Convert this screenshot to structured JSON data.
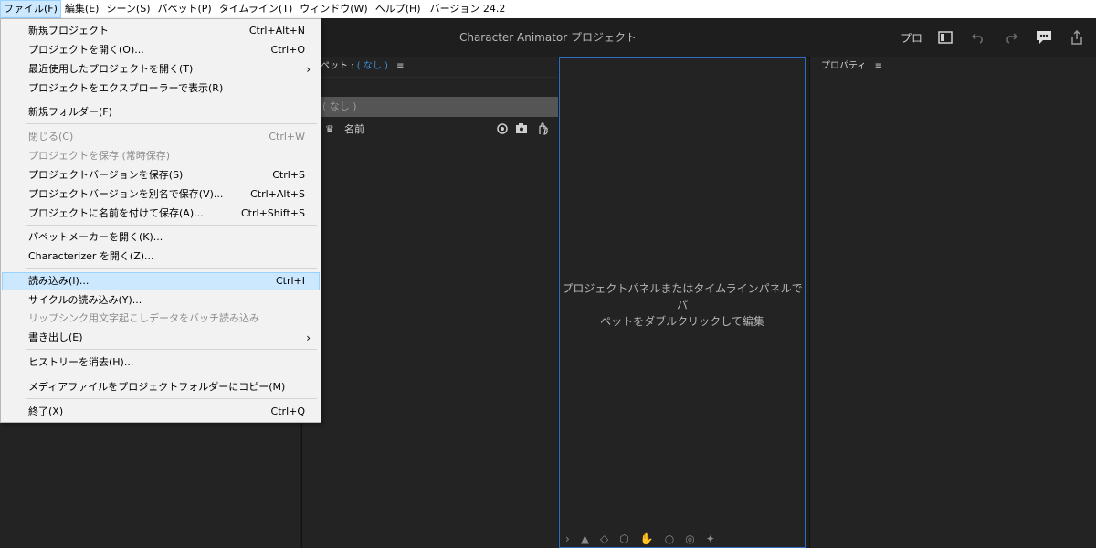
{
  "menubar": {
    "items": [
      "ファイル(F)",
      "編集(E)",
      "シーン(S)",
      "パペット(P)",
      "タイムライン(T)",
      "ウィンドウ(W)",
      "ヘルプ(H)"
    ],
    "version": "バージョン 24.2"
  },
  "header": {
    "title": "Character Animator プロジェクト",
    "mode_label": "プロ"
  },
  "puppet_panel": {
    "title_prefix": "ペット : ",
    "title_value": "( なし )",
    "row_value": "( なし )",
    "column_name": "名前"
  },
  "viewer": {
    "message_line1": "プロジェクトパネルまたはタイムラインパネルでパ",
    "message_line2": "ペットをダブルクリックして編集"
  },
  "properties": {
    "title": "プロパティ"
  },
  "file_menu": {
    "items": [
      {
        "label": "新規プロジェクト",
        "shortcut": "Ctrl+Alt+N"
      },
      {
        "label": "プロジェクトを開く(O)...",
        "shortcut": "Ctrl+O"
      },
      {
        "label": "最近使用したプロジェクトを開く(T)",
        "shortcut": ""
      },
      {
        "label": "プロジェクトをエクスプローラーで表示(R)",
        "shortcut": ""
      },
      {
        "label": "新規フォルダー(F)",
        "shortcut": ""
      },
      {
        "label": "閉じる(C)",
        "shortcut": "Ctrl+W"
      },
      {
        "label": "プロジェクトを保存 (常時保存)",
        "shortcut": ""
      },
      {
        "label": "プロジェクトバージョンを保存(S)",
        "shortcut": "Ctrl+S"
      },
      {
        "label": "プロジェクトバージョンを別名で保存(V)...",
        "shortcut": "Ctrl+Alt+S"
      },
      {
        "label": "プロジェクトに名前を付けて保存(A)...",
        "shortcut": "Ctrl+Shift+S"
      },
      {
        "label": "パペットメーカーを開く(K)...",
        "shortcut": ""
      },
      {
        "label": "Characterizer を開く(Z)...",
        "shortcut": ""
      },
      {
        "label": "読み込み(I)...",
        "shortcut": "Ctrl+I"
      },
      {
        "label": "サイクルの読み込み(Y)...",
        "shortcut": ""
      },
      {
        "label": "リップシンク用文字起こしデータをバッチ読み込み",
        "shortcut": ""
      },
      {
        "label": "書き出し(E)",
        "shortcut": ""
      },
      {
        "label": "ヒストリーを消去(H)...",
        "shortcut": ""
      },
      {
        "label": "メディアファイルをプロジェクトフォルダーにコピー(M)",
        "shortcut": ""
      },
      {
        "label": "終了(X)",
        "shortcut": "Ctrl+Q"
      }
    ]
  }
}
